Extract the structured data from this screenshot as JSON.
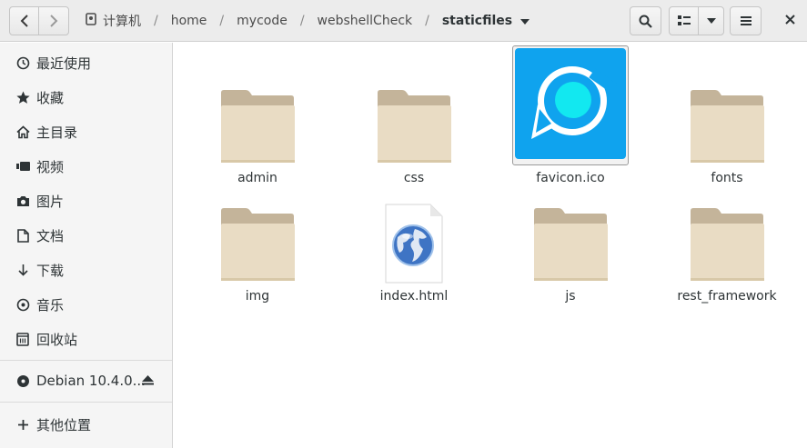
{
  "toolbar": {
    "back_icon": "go-previous-icon",
    "forward_icon": "go-next-icon",
    "search_icon": "search-icon",
    "view_icon": "list-view-icon",
    "view_menu_icon": "chevron-down-icon",
    "menu_icon": "hamburger-menu-icon",
    "close_icon": "close-icon"
  },
  "breadcrumb": {
    "items": [
      "计算机",
      "home",
      "mycode",
      "webshellCheck",
      "staticfiles"
    ],
    "separator": "/"
  },
  "sidebar": {
    "items": [
      {
        "label": "最近使用",
        "icon": "clock-icon"
      },
      {
        "label": "收藏",
        "icon": "star-icon"
      },
      {
        "label": "主目录",
        "icon": "home-icon"
      },
      {
        "label": "视频",
        "icon": "video-icon"
      },
      {
        "label": "图片",
        "icon": "camera-icon"
      },
      {
        "label": "文档",
        "icon": "document-icon"
      },
      {
        "label": "下载",
        "icon": "download-icon"
      },
      {
        "label": "音乐",
        "icon": "music-icon"
      },
      {
        "label": "回收站",
        "icon": "trash-icon"
      }
    ],
    "device": {
      "label": "Debian 10.4.0...",
      "icon": "disc-icon",
      "eject_icon": "eject-icon"
    },
    "other": {
      "label": "其他位置",
      "icon": "plus-icon"
    }
  },
  "files": [
    {
      "name": "admin",
      "type": "folder"
    },
    {
      "name": "css",
      "type": "folder"
    },
    {
      "name": "favicon.ico",
      "type": "image"
    },
    {
      "name": "fonts",
      "type": "folder"
    },
    {
      "name": "img",
      "type": "folder"
    },
    {
      "name": "index.html",
      "type": "html"
    },
    {
      "name": "js",
      "type": "folder"
    },
    {
      "name": "rest_framework",
      "type": "folder"
    }
  ],
  "colors": {
    "folder_tab": "#c4b49a",
    "folder_body": "#e9dcc4",
    "favicon_bg": "#0fa3ee",
    "favicon_dot": "#12e8f0"
  }
}
